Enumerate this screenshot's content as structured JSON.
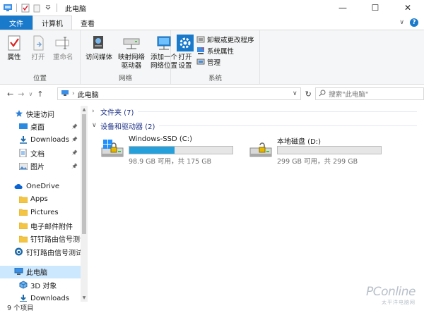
{
  "window": {
    "title": "此电脑",
    "controls": {
      "minimize": "—",
      "maximize": "☐",
      "close": "✕"
    }
  },
  "tabs": [
    {
      "label": "文件"
    },
    {
      "label": "计算机"
    },
    {
      "label": "查看"
    }
  ],
  "ribbon": {
    "groups": [
      {
        "label": "位置",
        "buttons": [
          "属性",
          "打开",
          "重命名"
        ]
      },
      {
        "label": "网络",
        "buttons": [
          "访问媒体",
          "映射网络\n驱动器",
          "添加一个\n网络位置"
        ]
      },
      {
        "label": "系统",
        "big_button": "打开\n设置",
        "small_buttons": [
          "卸载或更改程序",
          "系统属性",
          "管理"
        ]
      }
    ]
  },
  "address": {
    "crumb": "此电脑",
    "search_placeholder": "搜索\"此电脑\""
  },
  "nav": {
    "items": [
      {
        "label": "快速访问",
        "icon": "star-icon",
        "indent": 1
      },
      {
        "label": "桌面",
        "icon": "desktop-icon",
        "indent": 2,
        "pinned": true
      },
      {
        "label": "Downloads",
        "icon": "download-icon",
        "indent": 2,
        "pinned": true
      },
      {
        "label": "文档",
        "icon": "document-icon",
        "indent": 2,
        "pinned": true
      },
      {
        "label": "图片",
        "icon": "picture-icon",
        "indent": 2,
        "pinned": true
      },
      {
        "label": "",
        "icon": "",
        "indent": 0
      },
      {
        "label": "OneDrive",
        "icon": "cloud-icon",
        "indent": 1
      },
      {
        "label": "Apps",
        "icon": "folder-icon",
        "indent": 2
      },
      {
        "label": "Pictures",
        "icon": "folder-icon",
        "indent": 2
      },
      {
        "label": "电子邮件附件",
        "icon": "folder-icon",
        "indent": 2
      },
      {
        "label": "钉钉路由信号测试",
        "icon": "folder-icon",
        "indent": 2
      },
      {
        "label": "钉钉路由信号测试",
        "icon": "network-icon",
        "indent": 1
      },
      {
        "label": "",
        "icon": "",
        "indent": 0
      },
      {
        "label": "此电脑",
        "icon": "computer-icon",
        "indent": 1,
        "selected": true
      },
      {
        "label": "3D 对象",
        "icon": "cube-icon",
        "indent": 2
      },
      {
        "label": "Downloads",
        "icon": "download-icon",
        "indent": 2
      }
    ]
  },
  "content": {
    "folders_header": "文件夹 (7)",
    "devices_header": "设备和驱动器 (2)",
    "drives": [
      {
        "name": "Windows-SSD (C:)",
        "free_text": "98.9 GB 可用，共 175 GB",
        "used_fraction": 0.435,
        "icon": "windows-drive-icon"
      },
      {
        "name": "本地磁盘 (D:)",
        "free_text": "299 GB 可用，共 299 GB",
        "used_fraction": 0.0,
        "icon": "hard-drive-icon"
      }
    ]
  },
  "status": {
    "count": "9 个项目"
  },
  "watermark": {
    "line1": "PConline",
    "line2": "太平洋电脑网"
  },
  "colors": {
    "accent": "#1979ca",
    "selected": "#cce8ff",
    "bar_fill": "#26a0da",
    "group_header": "#1e3287"
  }
}
